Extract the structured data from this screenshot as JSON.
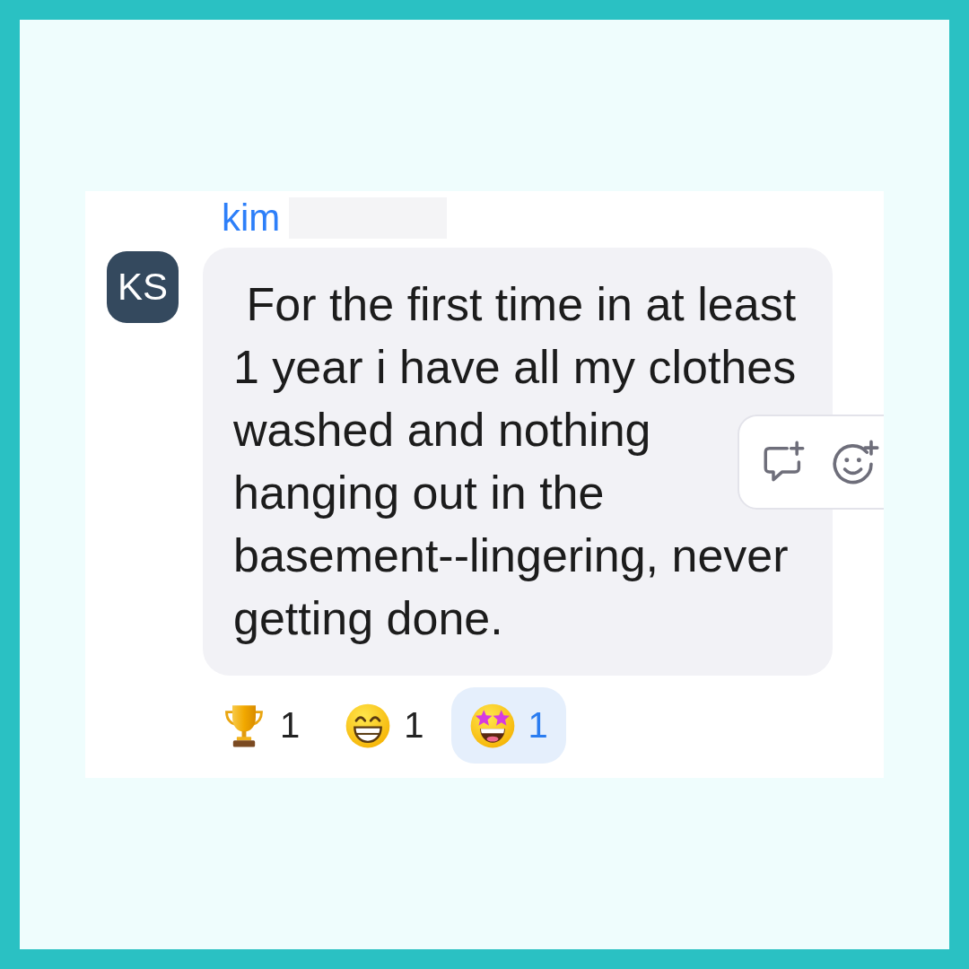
{
  "message": {
    "author": {
      "name": "kim",
      "surname_hidden": true
    },
    "avatar_initials": "KS",
    "text": " For the first time in at least\n1 year i have all my clothes\nwashed and nothing\nhanging out in the\nbasement--lingering, never\ngetting done."
  },
  "reactions": [
    {
      "kind": "trophy",
      "count": "1",
      "selected": false
    },
    {
      "kind": "grin",
      "count": "1",
      "selected": false
    },
    {
      "kind": "star_struck",
      "count": "1",
      "selected": true
    }
  ]
}
